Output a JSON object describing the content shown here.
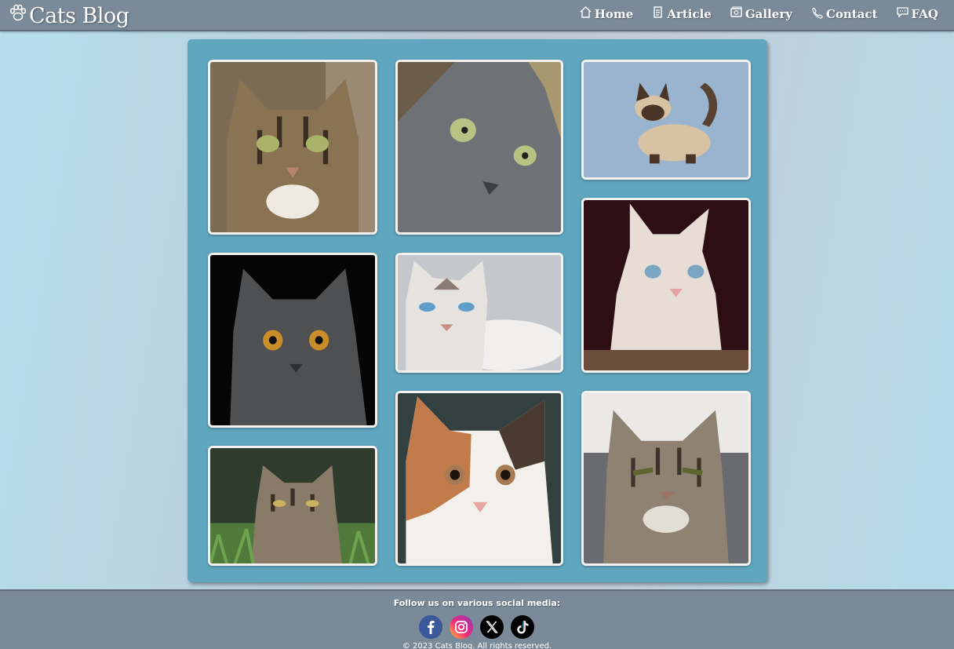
{
  "header": {
    "logo_text": "Cats Blog",
    "nav": [
      {
        "label": "Home",
        "icon": "home-icon"
      },
      {
        "label": "Article",
        "icon": "article-icon"
      },
      {
        "label": "Gallery",
        "icon": "gallery-icon"
      },
      {
        "label": "Contact",
        "icon": "contact-icon"
      },
      {
        "label": "FAQ",
        "icon": "faq-icon"
      }
    ]
  },
  "gallery": {
    "photos": [
      {
        "name": "tabby-cat-photo",
        "fur": "#8a7352"
      },
      {
        "name": "gray-cat-photo",
        "fur": "#6e7277"
      },
      {
        "name": "siamese-cat-photo",
        "fur": "#d8c2a4"
      },
      {
        "name": "white-kitten-photo",
        "fur": "#e8ddd5"
      },
      {
        "name": "black-cat-photo",
        "fur": "#4f5052"
      },
      {
        "name": "blue-eyed-cat-photo",
        "fur": "#e6e2de"
      },
      {
        "name": "grass-tabby-photo",
        "fur": "#8a7a68"
      },
      {
        "name": "calico-cat-photo",
        "fur": "#c89a6d"
      },
      {
        "name": "grumpy-tabby-photo",
        "fur": "#8e8272"
      }
    ]
  },
  "footer": {
    "follow_text": "Follow us on various social media:",
    "socials": [
      {
        "label": "f",
        "icon": "facebook-icon",
        "color": "#3b5998"
      },
      {
        "label": "",
        "icon": "instagram-icon",
        "color": "#d6249f"
      },
      {
        "label": "",
        "icon": "x-icon",
        "color": "#000000"
      },
      {
        "label": "",
        "icon": "tiktok-icon",
        "color": "#000000"
      }
    ],
    "copyright": "© 2023 Cats Blog. All rights reserved."
  },
  "colors": {
    "header": "#7b8a99",
    "panel": "#5fa6bf",
    "frame": "#f4f1ee"
  }
}
